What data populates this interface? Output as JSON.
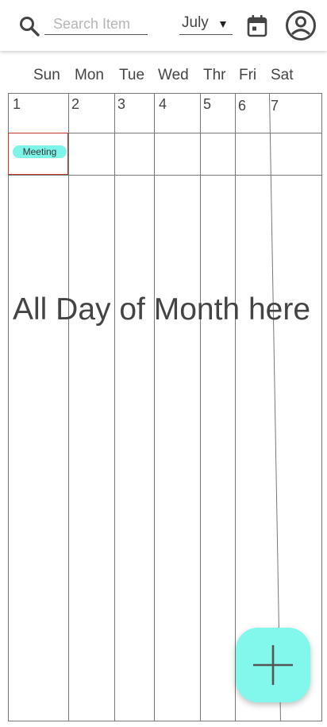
{
  "search": {
    "placeholder": "Search Item",
    "value": ""
  },
  "month_select": {
    "selected": "July"
  },
  "weekdays": [
    "Sun",
    "Mon",
    "Tue",
    "Wed",
    "Thr",
    "Fri",
    "Sat"
  ],
  "days": [
    "1",
    "2",
    "3",
    "4",
    "5",
    "6",
    "7"
  ],
  "event": {
    "label": "Meeting",
    "color": "#7ff5ea"
  },
  "placeholder_text": "All Day of Month here",
  "colors": {
    "accent": "#82f7ec",
    "event_border": "#c0392b",
    "grid_line": "#777777"
  },
  "icons": {
    "search": "search-icon",
    "calendar": "calendar-icon",
    "profile": "account-circle-icon",
    "add": "plus-icon"
  }
}
